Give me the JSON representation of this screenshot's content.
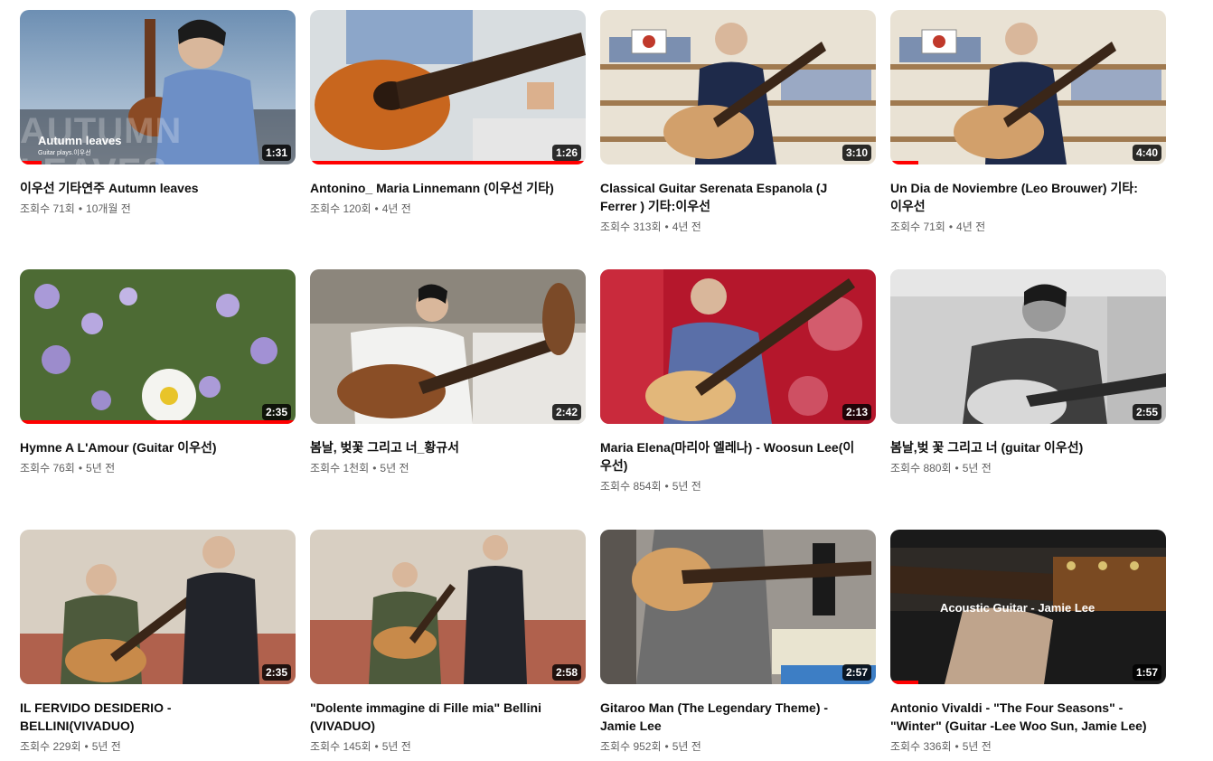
{
  "videos": [
    {
      "title": "이우선 기타연주 Autumn leaves",
      "views": "조회수 71회",
      "age": "10개월 전",
      "duration": "1:31",
      "progress": 0.08,
      "overlay_big": "AUTUMN LEAVES",
      "overlay_title": "Autumn leaves",
      "overlay_sub": "Guitar plays.이우선"
    },
    {
      "title": "Antonino_ Maria Linnemann (이우선 기타)",
      "views": "조회수 120회",
      "age": "4년 전",
      "duration": "1:26",
      "progress": 1.0
    },
    {
      "title": "Classical Guitar Serenata Espanola (J Ferrer ) 기타:이우선",
      "views": "조회수 313회",
      "age": "4년 전",
      "duration": "3:10",
      "progress": 0
    },
    {
      "title": "Un Dia de Noviembre (Leo Brouwer) 기타:이우선",
      "views": "조회수 71회",
      "age": "4년 전",
      "duration": "4:40",
      "progress": 0.1
    },
    {
      "title": "Hymne A L'Amour (Guitar 이우선)",
      "views": "조회수 76회",
      "age": "5년 전",
      "duration": "2:35",
      "progress": 1.0
    },
    {
      "title": "봄날, 벚꽃 그리고 너_황규서",
      "views": "조회수 1천회",
      "age": "5년 전",
      "duration": "2:42",
      "progress": 0
    },
    {
      "title": "Maria Elena(마리아 엘레나) - Woosun Lee(이우선)",
      "views": "조회수 854회",
      "age": "5년 전",
      "duration": "2:13",
      "progress": 0
    },
    {
      "title": "봄날,벚 꽃 그리고 너 (guitar 이우선)",
      "views": "조회수 880회",
      "age": "5년 전",
      "duration": "2:55",
      "progress": 0
    },
    {
      "title": "IL FERVIDO DESIDERIO - BELLINI(VIVADUO)",
      "views": "조회수 229회",
      "age": "5년 전",
      "duration": "2:35",
      "progress": 0
    },
    {
      "title": "\"Dolente immagine di Fille mia\" Bellini (VIVADUO)",
      "views": "조회수 145회",
      "age": "5년 전",
      "duration": "2:58",
      "progress": 0
    },
    {
      "title": "Gitaroo Man (The Legendary Theme) - Jamie Lee",
      "views": "조회수 952회",
      "age": "5년 전",
      "duration": "2:57",
      "progress": 0
    },
    {
      "title": "Antonio Vivaldi - \"The Four Seasons\" - \"Winter\" (Guitar -Lee Woo Sun, Jamie Lee)",
      "views": "조회수 336회",
      "age": "5년 전",
      "duration": "1:57",
      "progress": 0.1,
      "overlay_title": "Acoustic Guitar - Jamie Lee"
    }
  ],
  "separator": "•",
  "colors": {
    "progress": "#ff0000",
    "meta_text": "#606060",
    "title_text": "#0f0f0f"
  }
}
